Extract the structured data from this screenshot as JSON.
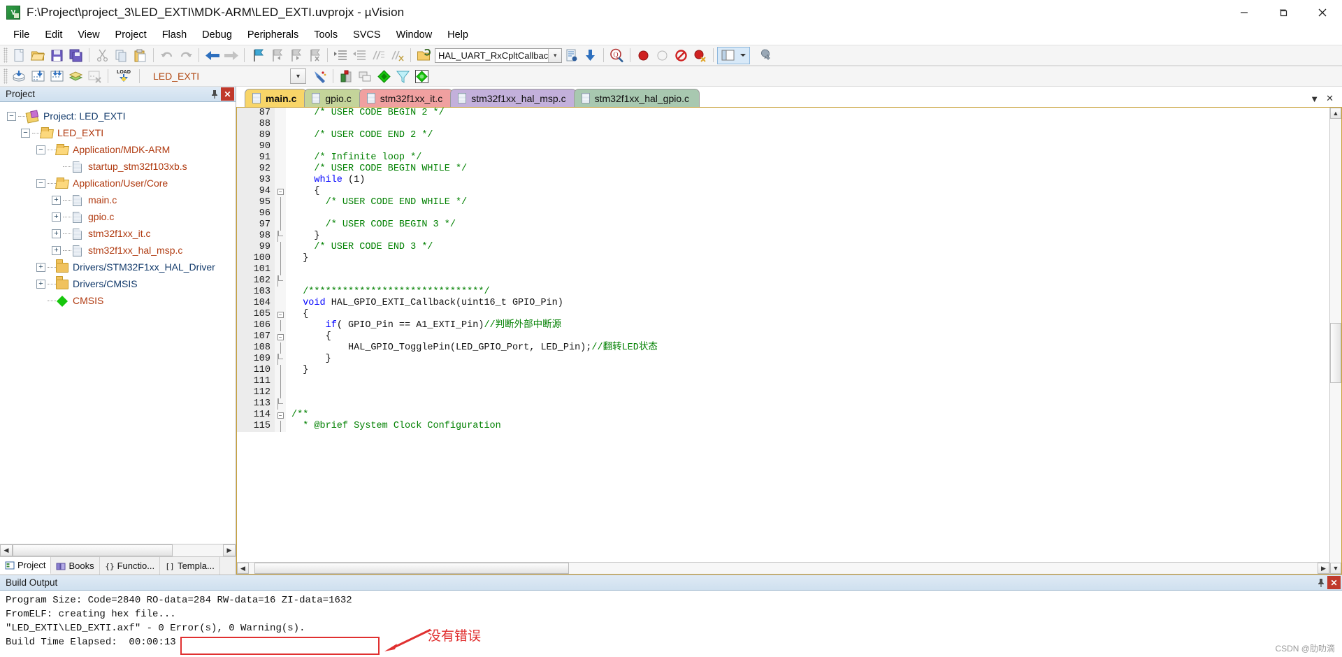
{
  "window": {
    "title": "F:\\Project\\project_3\\LED_EXTI\\MDK-ARM\\LED_EXTI.uvprojx - µVision",
    "app_icon": "uvision-icon",
    "minimize": "─",
    "maximize": "❐",
    "close": "✕"
  },
  "menu": [
    "File",
    "Edit",
    "View",
    "Project",
    "Flash",
    "Debug",
    "Peripherals",
    "Tools",
    "SVCS",
    "Window",
    "Help"
  ],
  "toolbar1": {
    "buttons": [
      {
        "name": "new-file-icon",
        "glyph": "new"
      },
      {
        "name": "open-file-icon",
        "glyph": "open"
      },
      {
        "name": "save-icon",
        "glyph": "save"
      },
      {
        "name": "save-all-icon",
        "glyph": "saveall"
      },
      {
        "name": "cut-icon",
        "glyph": "cut"
      },
      {
        "name": "copy-icon",
        "glyph": "copy"
      },
      {
        "name": "paste-icon",
        "glyph": "paste"
      },
      {
        "name": "undo-icon",
        "glyph": "undo"
      },
      {
        "name": "redo-icon",
        "glyph": "redo"
      },
      {
        "name": "navigate-back-icon",
        "glyph": "back"
      },
      {
        "name": "navigate-forward-icon",
        "glyph": "forward"
      },
      {
        "name": "bookmark-toggle-icon",
        "glyph": "bookmark"
      },
      {
        "name": "bookmark-prev-icon",
        "glyph": "bm-prev"
      },
      {
        "name": "bookmark-next-icon",
        "glyph": "bm-next"
      },
      {
        "name": "bookmark-clear-icon",
        "glyph": "bm-clear"
      },
      {
        "name": "indent-icon",
        "glyph": "indent"
      },
      {
        "name": "outdent-icon",
        "glyph": "outdent"
      },
      {
        "name": "comment-icon",
        "glyph": "comment"
      },
      {
        "name": "uncomment-icon",
        "glyph": "uncomment"
      },
      {
        "name": "open-function-icon",
        "glyph": "openfn"
      }
    ],
    "function_combo_value": "HAL_UART_RxCpltCallbac",
    "after_combo_buttons": [
      {
        "name": "insert-file-icon",
        "glyph": "insert-file"
      },
      {
        "name": "download-icon",
        "glyph": "download"
      },
      {
        "name": "find-in-files-icon",
        "glyph": "find"
      },
      {
        "name": "start-debug-icon",
        "glyph": "debug-red"
      },
      {
        "name": "stop-debug-icon",
        "glyph": "debug-gray"
      },
      {
        "name": "disable-breakpoints-icon",
        "glyph": "bp-disable"
      },
      {
        "name": "kill-breakpoints-icon",
        "glyph": "bp-kill"
      },
      {
        "name": "window-layout-icon",
        "glyph": "layout"
      },
      {
        "name": "layout-dropdown-icon",
        "glyph": "chev"
      },
      {
        "name": "configuration-wizard-icon",
        "glyph": "wrench"
      }
    ]
  },
  "toolbar2": {
    "buttons": [
      {
        "name": "translate-icon",
        "glyph": "translate"
      },
      {
        "name": "build-icon",
        "glyph": "build"
      },
      {
        "name": "rebuild-icon",
        "glyph": "rebuild"
      },
      {
        "name": "batch-build-icon",
        "glyph": "batch"
      },
      {
        "name": "stop-build-icon",
        "glyph": "stopbuild"
      },
      {
        "name": "load-icon",
        "glyph": "load"
      }
    ],
    "target_value": "LED_EXTI",
    "after_target_buttons": [
      {
        "name": "target-options-icon",
        "glyph": "target-options"
      },
      {
        "name": "manage-project-items-icon",
        "glyph": "manage"
      },
      {
        "name": "manage-run-time-env-icon",
        "glyph": "rte"
      },
      {
        "name": "pack-installer-icon",
        "glyph": "pack"
      },
      {
        "name": "select-software-packs-icon",
        "glyph": "packs2"
      }
    ]
  },
  "project_pane": {
    "title": "Project",
    "pin_icon": "pin-icon",
    "close_icon": "close-icon",
    "tree": [
      {
        "label": "Project: LED_EXTI",
        "indent": 0,
        "expander": "−",
        "icon": "project-icon",
        "color": "blue"
      },
      {
        "label": "LED_EXTI",
        "indent": 1,
        "expander": "−",
        "icon": "target-folder-icon",
        "color": "orange"
      },
      {
        "label": "Application/MDK-ARM",
        "indent": 2,
        "expander": "−",
        "icon": "folder-open-icon",
        "color": "orange"
      },
      {
        "label": "startup_stm32f103xb.s",
        "indent": 3,
        "expander": "",
        "icon": "file-icon",
        "color": "orange"
      },
      {
        "label": "Application/User/Core",
        "indent": 2,
        "expander": "−",
        "icon": "folder-open-icon",
        "color": "orange"
      },
      {
        "label": "main.c",
        "indent": 3,
        "expander": "+",
        "icon": "file-icon",
        "color": "orange"
      },
      {
        "label": "gpio.c",
        "indent": 3,
        "expander": "+",
        "icon": "file-icon",
        "color": "orange"
      },
      {
        "label": "stm32f1xx_it.c",
        "indent": 3,
        "expander": "+",
        "icon": "file-icon",
        "color": "orange"
      },
      {
        "label": "stm32f1xx_hal_msp.c",
        "indent": 3,
        "expander": "+",
        "icon": "file-icon",
        "color": "orange"
      },
      {
        "label": "Drivers/STM32F1xx_HAL_Driver",
        "indent": 2,
        "expander": "+",
        "icon": "folder-icon",
        "color": "blue"
      },
      {
        "label": "Drivers/CMSIS",
        "indent": 2,
        "expander": "+",
        "icon": "folder-icon",
        "color": "blue"
      },
      {
        "label": "CMSIS",
        "indent": 2,
        "expander": "",
        "icon": "cmsis-diamond-icon",
        "color": "orange"
      }
    ],
    "bottom_tabs": [
      {
        "label": "Project",
        "icon": "project-tab-icon",
        "active": true
      },
      {
        "label": "Books",
        "icon": "books-tab-icon",
        "active": false
      },
      {
        "label": "Functio...",
        "icon": "functions-tab-icon",
        "active": false
      },
      {
        "label": "Templa...",
        "icon": "templates-tab-icon",
        "active": false
      }
    ]
  },
  "editor": {
    "tabs": [
      {
        "label": "main.c",
        "color": "#f8d568",
        "active": true
      },
      {
        "label": "gpio.c",
        "color": "#c4d49a",
        "active": false
      },
      {
        "label": "stm32f1xx_it.c",
        "color": "#f0a0a0",
        "active": false
      },
      {
        "label": "stm32f1xx_hal_msp.c",
        "color": "#c3b0db",
        "active": false
      },
      {
        "label": "stm32f1xx_hal_gpio.c",
        "color": "#a8c8b0",
        "active": false
      }
    ],
    "tab_menu_icon": "chevron-down-icon",
    "tab_close_icon": "close-icon",
    "lines": [
      {
        "n": 87,
        "fold": "",
        "segments": [
          {
            "t": "    /* USER CODE BEGIN 2 */",
            "c": "cm"
          }
        ]
      },
      {
        "n": 88,
        "fold": "",
        "segments": [
          {
            "t": "",
            "c": ""
          }
        ]
      },
      {
        "n": 89,
        "fold": "",
        "segments": [
          {
            "t": "    /* USER CODE END 2 */",
            "c": "cm"
          }
        ]
      },
      {
        "n": 90,
        "fold": "",
        "segments": [
          {
            "t": "",
            "c": ""
          }
        ]
      },
      {
        "n": 91,
        "fold": "",
        "segments": [
          {
            "t": "    /* Infinite loop */",
            "c": "cm"
          }
        ]
      },
      {
        "n": 92,
        "fold": "",
        "segments": [
          {
            "t": "    /* USER CODE BEGIN WHILE */",
            "c": "cm"
          }
        ]
      },
      {
        "n": 93,
        "fold": "",
        "segments": [
          {
            "t": "    ",
            "c": ""
          },
          {
            "t": "while",
            "c": "kw"
          },
          {
            "t": " (1)",
            "c": ""
          }
        ]
      },
      {
        "n": 94,
        "fold": "minus",
        "segments": [
          {
            "t": "    {",
            "c": ""
          }
        ]
      },
      {
        "n": 95,
        "fold": "bar",
        "segments": [
          {
            "t": "      /* USER CODE END WHILE */",
            "c": "cm"
          }
        ]
      },
      {
        "n": 96,
        "fold": "bar",
        "segments": [
          {
            "t": "",
            "c": ""
          }
        ]
      },
      {
        "n": 97,
        "fold": "bar",
        "segments": [
          {
            "t": "      /* USER CODE BEGIN 3 */",
            "c": "cm"
          }
        ]
      },
      {
        "n": 98,
        "fold": "end",
        "segments": [
          {
            "t": "    }",
            "c": ""
          }
        ]
      },
      {
        "n": 99,
        "fold": "bar",
        "segments": [
          {
            "t": "    /* USER CODE END 3 */",
            "c": "cm"
          }
        ]
      },
      {
        "n": 100,
        "fold": "bar",
        "segments": [
          {
            "t": "  }",
            "c": ""
          }
        ]
      },
      {
        "n": 101,
        "fold": "bar",
        "segments": [
          {
            "t": "",
            "c": ""
          }
        ]
      },
      {
        "n": 102,
        "fold": "end",
        "segments": [
          {
            "t": "",
            "c": ""
          }
        ]
      },
      {
        "n": 103,
        "fold": "",
        "segments": [
          {
            "t": "  /*******************************/",
            "c": "cm"
          }
        ]
      },
      {
        "n": 104,
        "fold": "",
        "segments": [
          {
            "t": "  ",
            "c": ""
          },
          {
            "t": "void",
            "c": "kw"
          },
          {
            "t": " HAL_GPIO_EXTI_Callback(uint16_t GPIO_Pin)",
            "c": ""
          }
        ]
      },
      {
        "n": 105,
        "fold": "minus",
        "segments": [
          {
            "t": "  {",
            "c": ""
          }
        ]
      },
      {
        "n": 106,
        "fold": "bar",
        "segments": [
          {
            "t": "      ",
            "c": ""
          },
          {
            "t": "if",
            "c": "kw"
          },
          {
            "t": "( GPIO_Pin == A1_EXTI_Pin)",
            "c": ""
          },
          {
            "t": "//判断外部中断源",
            "c": "cm"
          }
        ]
      },
      {
        "n": 107,
        "fold": "minus",
        "segments": [
          {
            "t": "      {",
            "c": ""
          }
        ]
      },
      {
        "n": 108,
        "fold": "bar",
        "segments": [
          {
            "t": "          HAL_GPIO_TogglePin(LED_GPIO_Port, LED_Pin);",
            "c": ""
          },
          {
            "t": "//翻转LED状态",
            "c": "cm"
          }
        ]
      },
      {
        "n": 109,
        "fold": "end",
        "segments": [
          {
            "t": "      }",
            "c": ""
          }
        ]
      },
      {
        "n": 110,
        "fold": "bar",
        "segments": [
          {
            "t": "  }",
            "c": ""
          }
        ]
      },
      {
        "n": 111,
        "fold": "bar",
        "segments": [
          {
            "t": "",
            "c": ""
          }
        ]
      },
      {
        "n": 112,
        "fold": "bar",
        "segments": [
          {
            "t": "",
            "c": ""
          }
        ]
      },
      {
        "n": 113,
        "fold": "end",
        "segments": [
          {
            "t": "",
            "c": ""
          }
        ]
      },
      {
        "n": 114,
        "fold": "minus",
        "segments": [
          {
            "t": "/**",
            "c": "cm"
          }
        ]
      },
      {
        "n": 115,
        "fold": "bar",
        "segments": [
          {
            "t": "  * @brief System Clock Configuration",
            "c": "cm"
          }
        ]
      }
    ]
  },
  "build_output": {
    "title": "Build Output",
    "pin_icon": "pin-icon",
    "close_icon": "close-icon",
    "lines": [
      "Program Size: Code=2840 RO-data=284 RW-data=16 ZI-data=1632",
      "FromELF: creating hex file...",
      "\"LED_EXTI\\LED_EXTI.axf\" - 0 Error(s), 0 Warning(s).",
      "Build Time Elapsed:  00:00:13"
    ],
    "annotation_text": "没有错误",
    "annotation_color": "#e03030",
    "watermark": "CSDN @肋叻滴"
  }
}
